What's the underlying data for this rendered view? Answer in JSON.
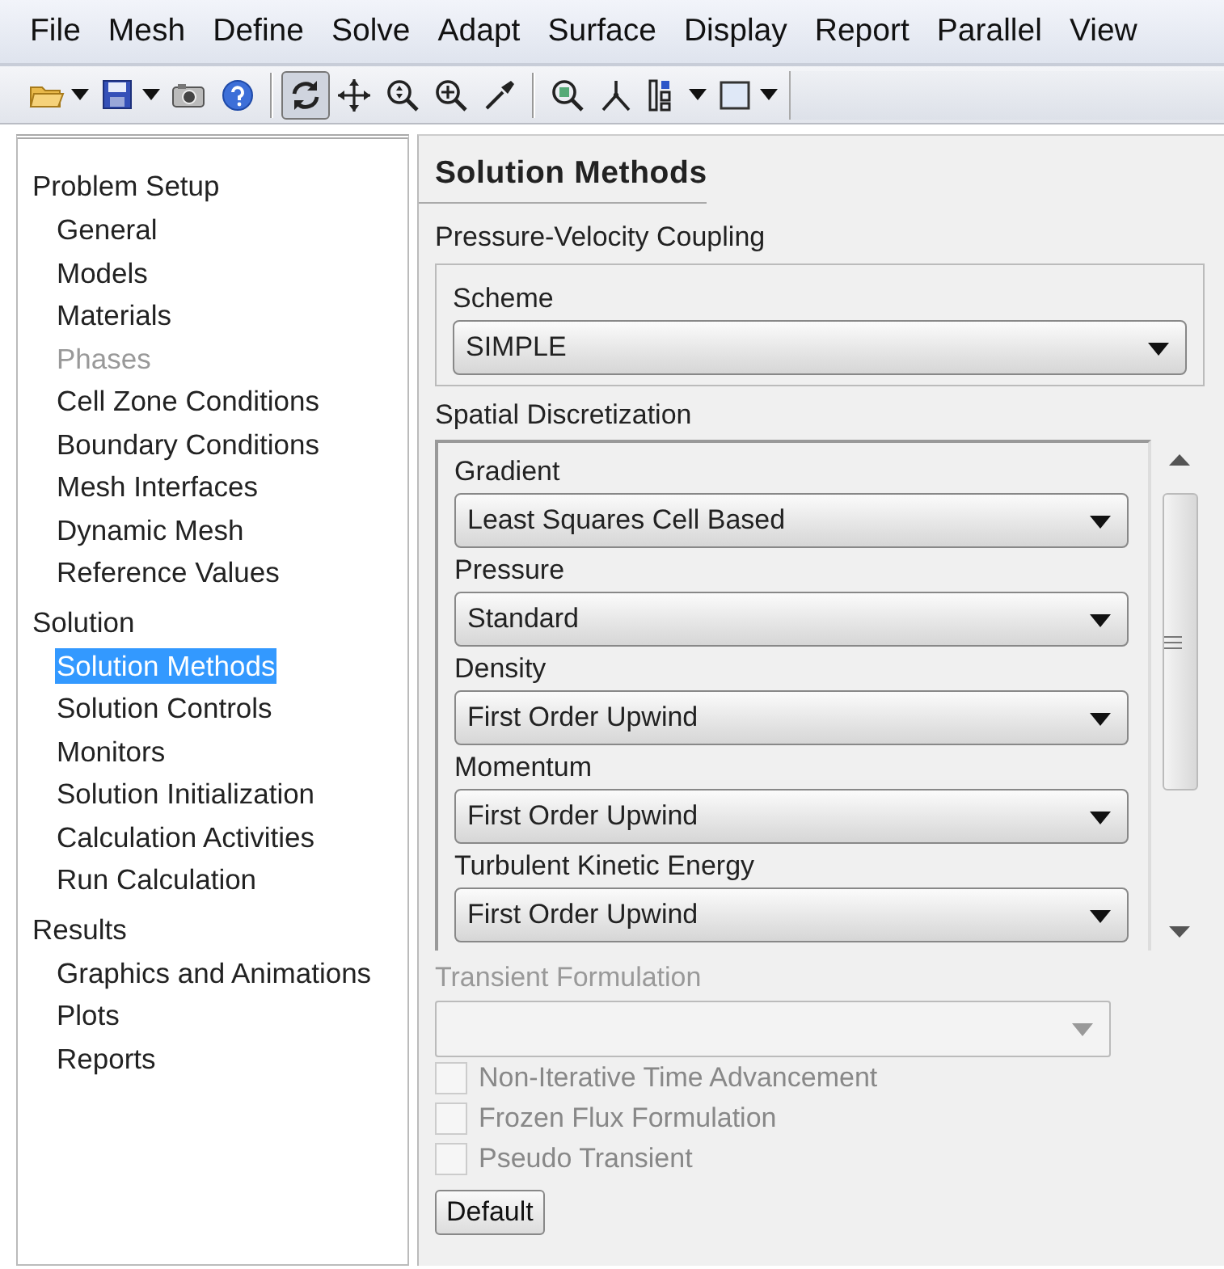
{
  "menu_bar": [
    "File",
    "Mesh",
    "Define",
    "Solve",
    "Adapt",
    "Surface",
    "Display",
    "Report",
    "Parallel",
    "View"
  ],
  "toolbar": [
    {
      "kind": "folder",
      "dropdown": true,
      "pressed": false
    },
    {
      "kind": "disk",
      "dropdown": true,
      "pressed": false
    },
    {
      "kind": "camera",
      "dropdown": false,
      "pressed": false
    },
    {
      "kind": "help",
      "dropdown": false,
      "pressed": false
    },
    {
      "kind": "separator"
    },
    {
      "kind": "rotate",
      "dropdown": false,
      "pressed": true
    },
    {
      "kind": "move",
      "dropdown": false,
      "pressed": false
    },
    {
      "kind": "zoomfit",
      "dropdown": false,
      "pressed": false
    },
    {
      "kind": "zoomin",
      "dropdown": false,
      "pressed": false
    },
    {
      "kind": "probe",
      "dropdown": false,
      "pressed": false
    },
    {
      "kind": "separator"
    },
    {
      "kind": "zoombox",
      "dropdown": false,
      "pressed": false
    },
    {
      "kind": "axes",
      "dropdown": false,
      "pressed": false
    },
    {
      "kind": "layout",
      "dropdown": true,
      "pressed": false
    },
    {
      "kind": "frame",
      "dropdown": true,
      "pressed": false
    }
  ],
  "tree": [
    {
      "label": "Problem Setup",
      "children": [
        {
          "label": "General",
          "selected": false,
          "disabled": false
        },
        {
          "label": "Models",
          "selected": false,
          "disabled": false
        },
        {
          "label": "Materials",
          "selected": false,
          "disabled": false
        },
        {
          "label": "Phases",
          "selected": false,
          "disabled": true
        },
        {
          "label": "Cell Zone Conditions",
          "selected": false,
          "disabled": false
        },
        {
          "label": "Boundary Conditions",
          "selected": false,
          "disabled": false
        },
        {
          "label": "Mesh Interfaces",
          "selected": false,
          "disabled": false
        },
        {
          "label": "Dynamic Mesh",
          "selected": false,
          "disabled": false
        },
        {
          "label": "Reference Values",
          "selected": false,
          "disabled": false
        }
      ]
    },
    {
      "label": "Solution",
      "children": [
        {
          "label": "Solution Methods",
          "selected": true,
          "disabled": false
        },
        {
          "label": "Solution Controls",
          "selected": false,
          "disabled": false
        },
        {
          "label": "Monitors",
          "selected": false,
          "disabled": false
        },
        {
          "label": "Solution Initialization",
          "selected": false,
          "disabled": false
        },
        {
          "label": "Calculation Activities",
          "selected": false,
          "disabled": false
        },
        {
          "label": "Run Calculation",
          "selected": false,
          "disabled": false
        }
      ]
    },
    {
      "label": "Results",
      "children": [
        {
          "label": "Graphics and Animations",
          "selected": false,
          "disabled": false
        },
        {
          "label": "Plots",
          "selected": false,
          "disabled": false
        },
        {
          "label": "Reports",
          "selected": false,
          "disabled": false
        }
      ]
    }
  ],
  "panel": {
    "title": "Solution Methods",
    "coupling": {
      "heading": "Pressure-Velocity Coupling",
      "label": "Scheme",
      "value": "SIMPLE"
    },
    "spatial": {
      "heading": "Spatial Discretization",
      "items": [
        {
          "label": "Gradient",
          "value": "Least Squares Cell Based"
        },
        {
          "label": "Pressure",
          "value": "Standard"
        },
        {
          "label": "Density",
          "value": "First Order Upwind"
        },
        {
          "label": "Momentum",
          "value": "First Order Upwind"
        },
        {
          "label": "Turbulent Kinetic Energy",
          "value": "First Order Upwind"
        }
      ]
    },
    "transient": {
      "label": "Transient Formulation",
      "disabled": true
    },
    "options": [
      {
        "label": "Non-Iterative Time Advancement",
        "checked": false,
        "disabled": true
      },
      {
        "label": "Frozen Flux Formulation",
        "checked": false,
        "disabled": true
      },
      {
        "label": "Pseudo Transient",
        "checked": false,
        "disabled": true
      }
    ],
    "button": "Default"
  }
}
